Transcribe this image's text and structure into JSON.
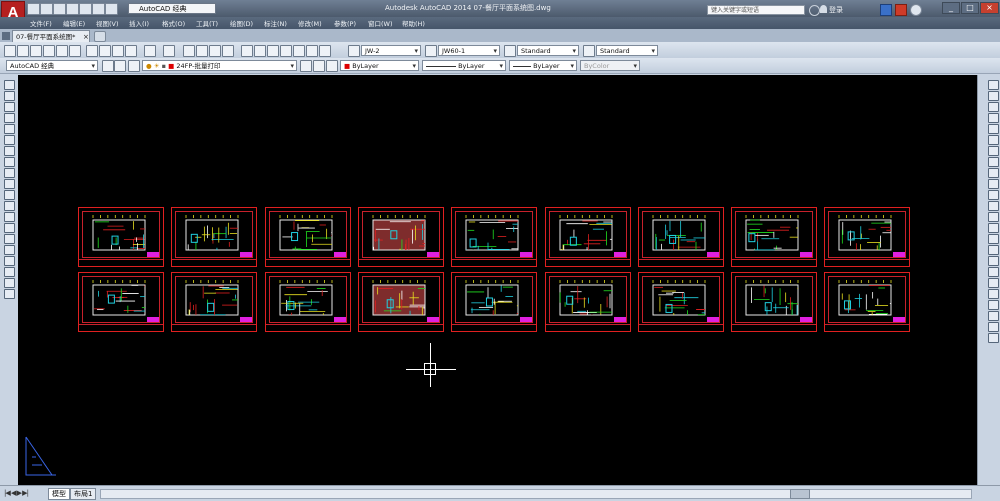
{
  "app": {
    "logo": "A",
    "workspace": "AutoCAD 经典",
    "window_title": "Autodesk AutoCAD 2014    07-餐厅平面系统图.dwg",
    "search_placeholder": "键入关键字或短语",
    "login": "登录"
  },
  "window_buttons": [
    "_",
    "□",
    "×"
  ],
  "menu": [
    "文件(F)",
    "编辑(E)",
    "视图(V)",
    "插入(I)",
    "格式(O)",
    "工具(T)",
    "绘图(D)",
    "标注(N)",
    "修改(M)",
    "参数(P)",
    "窗口(W)",
    "帮助(H)"
  ],
  "doc_tab": "07-餐厅平面系统图*",
  "toolbar_styles": {
    "text_style": "JW-2",
    "dim_style": "JW60-1",
    "table_style": "Standard",
    "multileader_style": "Standard"
  },
  "toolbar_layers": {
    "workspace": "AutoCAD 经典",
    "layer": "24FP-批量打印",
    "color": "ByLayer",
    "linetype": "ByLayer",
    "lineweight": "ByLayer",
    "plotstyle": "ByColor"
  },
  "layout_tabs": [
    "模型",
    "布局1"
  ],
  "colors": {
    "canvas": "#000000",
    "sheet_border": "#e02020",
    "accent_magenta": "#e020e0",
    "accent_cyan": "#20d0e0",
    "accent_yellow": "#e8e020"
  },
  "drawing": {
    "rows": 2,
    "sheets_per_row": 9
  }
}
